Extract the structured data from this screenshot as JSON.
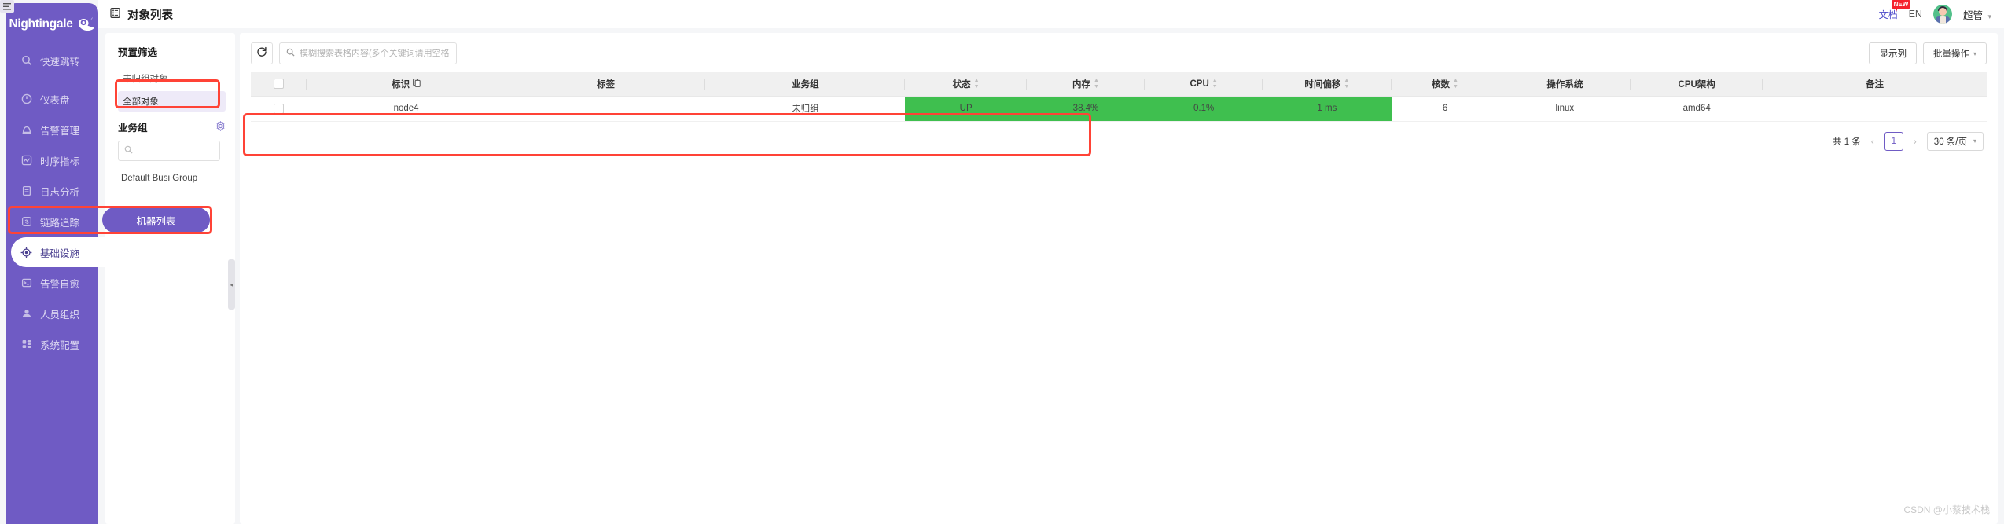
{
  "brand": {
    "name": "Nightingale",
    "bird_icon": "bird-logo-icon"
  },
  "collapse": {
    "icon": "collapse-panel-icon"
  },
  "sidebar": {
    "items": [
      {
        "label": "快速跳转",
        "icon": "search-icon",
        "active": false
      },
      {
        "label": "仪表盘",
        "icon": "dashboard-gauge-icon",
        "active": false
      },
      {
        "label": "告警管理",
        "icon": "alarm-bell-icon",
        "active": false
      },
      {
        "label": "时序指标",
        "icon": "line-chart-icon",
        "active": false
      },
      {
        "label": "日志分析",
        "icon": "document-log-icon",
        "active": false
      },
      {
        "label": "链路追踪",
        "icon": "link-chain-icon",
        "active": false
      },
      {
        "label": "基础设施",
        "icon": "target-crosshair-icon",
        "active": true
      },
      {
        "label": "告警自愈",
        "icon": "terminal-console-icon",
        "active": false
      },
      {
        "label": "人员组织",
        "icon": "user-person-icon",
        "active": false
      },
      {
        "label": "系统配置",
        "icon": "grid-settings-icon",
        "active": false
      }
    ]
  },
  "header": {
    "title": "对象列表",
    "title_icon": "list-database-icon",
    "doc_label": "文档",
    "doc_badge": "NEW",
    "lang_label": "EN",
    "user_name": "超管",
    "avatar_icon": "user-avatar",
    "caret_icon": "chevron-down-icon"
  },
  "filter_panel": {
    "title": "预置筛选",
    "rows": [
      {
        "label": "未归组对象",
        "selected": false
      },
      {
        "label": "全部对象",
        "selected": true
      }
    ],
    "group_title": "业务组",
    "gear_icon": "gear-settings-icon",
    "search_icon": "search-icon",
    "search_value": "",
    "groups": [
      {
        "label": "Default Busi Group"
      }
    ],
    "handle_icon": "collapse-left-icon"
  },
  "side_button": {
    "label": "机器列表"
  },
  "toolbar": {
    "refresh_icon": "refresh-icon",
    "search_icon": "search-icon",
    "search_placeholder": "模糊搜索表格内容(多个关键词请用空格分隔)",
    "search_value": "",
    "show_columns_label": "显示列",
    "batch_ops_label": "批量操作",
    "batch_ops_caret": "chevron-down-icon"
  },
  "table": {
    "select_all_icon": "checkbox-unchecked",
    "columns": [
      {
        "key": "checkbox",
        "label": "",
        "sortable": false,
        "width": "3.2%"
      },
      {
        "key": "ident",
        "label": "标识",
        "sortable": false,
        "copy_icon": "copy-icon",
        "width": "11.5%"
      },
      {
        "key": "tags",
        "label": "标签",
        "sortable": false,
        "width": "11.5%"
      },
      {
        "key": "group",
        "label": "业务组",
        "sortable": false,
        "width": "11.5%"
      },
      {
        "key": "status",
        "label": "状态",
        "sortable": true,
        "width": "7%"
      },
      {
        "key": "memory",
        "label": "内存",
        "sortable": true,
        "width": "6.8%"
      },
      {
        "key": "cpu",
        "label": "CPU",
        "sortable": true,
        "width": "6.8%"
      },
      {
        "key": "offset",
        "label": "时间偏移",
        "sortable": true,
        "width": "7.4%"
      },
      {
        "key": "cores",
        "label": "核数",
        "sortable": true,
        "width": "6.2%"
      },
      {
        "key": "os",
        "label": "操作系统",
        "sortable": false,
        "width": "7.6%"
      },
      {
        "key": "arch",
        "label": "CPU架构",
        "sortable": false,
        "width": "7.6%"
      },
      {
        "key": "note",
        "label": "备注",
        "sortable": false,
        "width": "12.9%"
      }
    ],
    "rows": [
      {
        "checkbox": "",
        "ident": "node4",
        "tags": "",
        "group": "未归组",
        "status": "UP",
        "memory": "38.4%",
        "cpu": "0.1%",
        "offset": "1 ms",
        "cores": "6",
        "os": "linux",
        "arch": "amd64",
        "note": ""
      }
    ],
    "green_cells": [
      "status",
      "memory",
      "cpu",
      "offset"
    ]
  },
  "pagination": {
    "total_label": "共 1 条",
    "prev_icon": "chevron-left-icon",
    "current_page": "1",
    "next_icon": "chevron-right-icon",
    "page_size_label": "30 条/页",
    "page_size_caret": "chevron-down-icon"
  },
  "colors": {
    "brand_purple": "#6f5bc4",
    "status_green": "#3fbf4f",
    "annotation_red": "#ff4336",
    "doc_blue": "#4a47c9",
    "badge_red": "#f5222d"
  },
  "watermark": {
    "text": "CSDN @小蔡技术栈"
  }
}
